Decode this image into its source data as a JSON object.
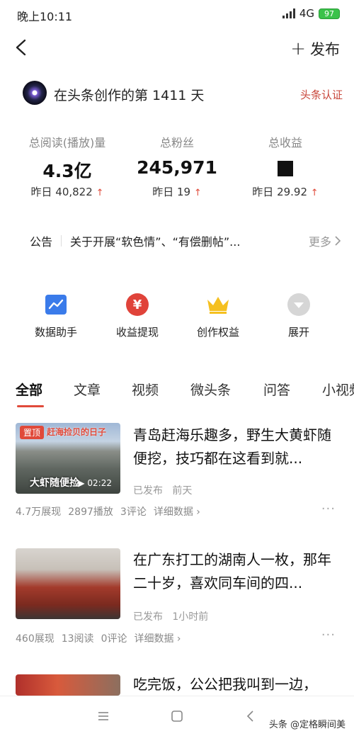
{
  "status_bar": {
    "time": "晚上10:11",
    "network": "4G",
    "battery": "97"
  },
  "header": {
    "publish_label": "发布",
    "back_icon": "back-arrow-icon",
    "plus_icon": "plus-icon"
  },
  "creator": {
    "days_text": "在头条创作的第 1411 天",
    "cert_label": "头条认证"
  },
  "stats": [
    {
      "label": "总阅读(播放)量",
      "value": "4.3亿",
      "yesterday": "昨日 40,822"
    },
    {
      "label": "总粉丝",
      "value": "245,971",
      "yesterday": "昨日 19"
    },
    {
      "label": "总收益",
      "value": "",
      "yesterday": "昨日 29.92"
    }
  ],
  "notice": {
    "tag": "公告",
    "text": "关于开展“软色情”、“有偿删帖”...",
    "more": "更多"
  },
  "shortcuts": [
    {
      "label": "数据助手",
      "icon": "chart-icon",
      "color": "#3a7bea"
    },
    {
      "label": "收益提现",
      "icon": "yuan-icon",
      "color": "#e0433a"
    },
    {
      "label": "创作权益",
      "icon": "crown-icon",
      "color": "#f5c020"
    },
    {
      "label": "展开",
      "icon": "expand-chevron-icon",
      "color": "#cfcfcf"
    }
  ],
  "tabs": [
    "全部",
    "文章",
    "视频",
    "微头条",
    "问答",
    "小视频"
  ],
  "articles": [
    {
      "pin_label": "置顶",
      "thumb_caption": "赶海捡贝的日子",
      "thumb_caption2": "大虾随便捡",
      "duration": "02:22",
      "title": "青岛赶海乐趣多，野生大黄虾随便挖，技巧都在这看到就...",
      "status": "已发布",
      "time": "前天",
      "stats": [
        "4.7万展现",
        "2897播放",
        "3评论",
        "详细数据"
      ]
    },
    {
      "title": "在广东打工的湖南人一枚，那年二十岁，喜欢同车间的四...",
      "status": "已发布",
      "time": "1小时前",
      "stats": [
        "460展现",
        "13阅读",
        "0评论",
        "详细数据"
      ]
    },
    {
      "title": "吃完饭，公公把我叫到一边，"
    }
  ],
  "watermark": "头条 @定格瞬间美"
}
